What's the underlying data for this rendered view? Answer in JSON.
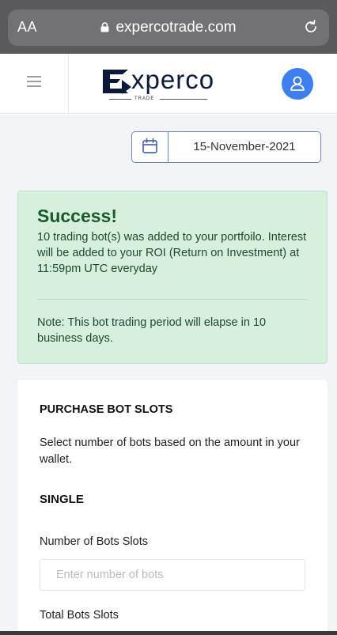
{
  "browser": {
    "text_size_label": "AA",
    "url": "expercotrade.com"
  },
  "header": {
    "logo_text": "xperco",
    "logo_tagline": "TRADE"
  },
  "date_picker": {
    "value": "15-November-2021"
  },
  "alert": {
    "title": "Success!",
    "message": "10 trading bot(s) was added to your portfoilo. Interest will be added to your ROI (Return on Investment) at 11:59pm UTC everyday",
    "note": "Note: This bot trading period will elapse in 10 business days."
  },
  "purchase": {
    "title": "PURCHASE BOT SLOTS",
    "description": "Select number of bots based on the amount in your wallet.",
    "section": "SINGLE",
    "bots_label": "Number of Bots Slots",
    "bots_placeholder": "Enter number of bots",
    "total_label": "Total Bots Slots"
  },
  "colors": {
    "brand_blue": "#3d7ff0",
    "success_bg": "#d7f0de",
    "success_text": "#1c5a2e",
    "date_border": "#6f87c2"
  },
  "icons": [
    "lock-icon",
    "reload-icon",
    "menu-icon",
    "logo-mark-icon",
    "user-icon",
    "calendar-icon"
  ]
}
